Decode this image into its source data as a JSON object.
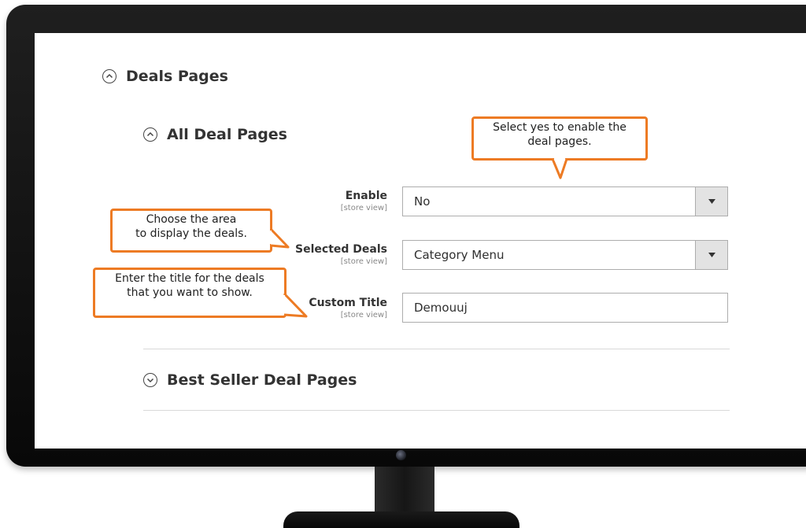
{
  "sections": {
    "deals_pages": {
      "title": "Deals Pages"
    },
    "all_deal_pages": {
      "title": "All Deal Pages"
    },
    "best_seller_deal_pages": {
      "title": "Best Seller Deal Pages"
    }
  },
  "fields": {
    "enable": {
      "label": "Enable",
      "scope": "[store view]",
      "value": "No"
    },
    "selected_deals": {
      "label": "Selected Deals",
      "scope": "[store view]",
      "value": "Category Menu"
    },
    "custom_title": {
      "label": "Custom Title",
      "scope": "[store view]",
      "value": "Demouuj"
    }
  },
  "callouts": {
    "enable_tip": {
      "line1": "Select yes to enable the",
      "line2": "deal pages."
    },
    "selected_deals_tip": {
      "line1": "Choose the area",
      "line2": "to display the deals."
    },
    "custom_title_tip": {
      "line1": "Enter the title for the deals",
      "line2": "that you want to show."
    }
  },
  "colors": {
    "callout_border": "#ed7b24",
    "text": "#333333",
    "input_border": "#adadad"
  }
}
